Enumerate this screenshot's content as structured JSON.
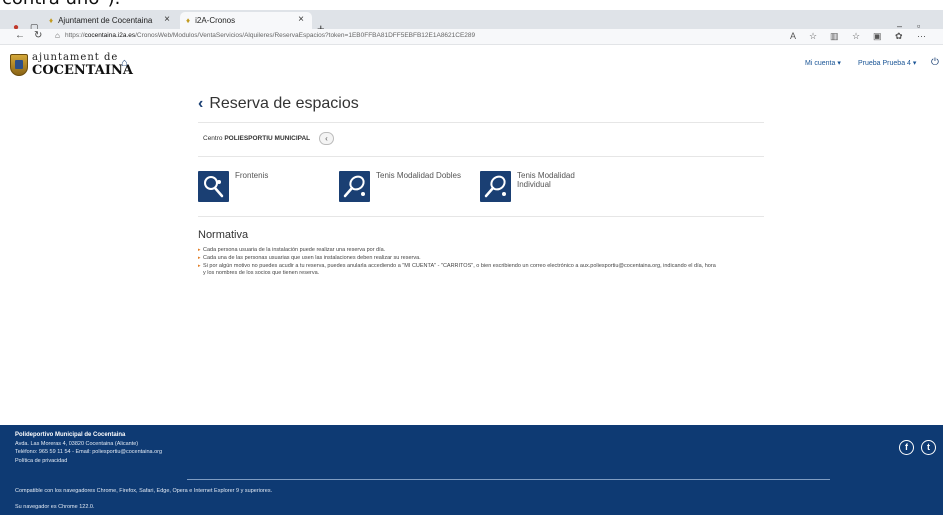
{
  "overlay_text": "contra uno\").",
  "browser": {
    "tabs": [
      {
        "title": "Ajuntament de Cocentaina"
      },
      {
        "title": "i2A-Cronos"
      }
    ],
    "url_prefix": "https://",
    "url_host": "cocentaina.i2a.es",
    "url_path": "/CronosWeb/Modulos/VentaServicios/Alquileres/ReservaEspacios?token=1EB0FFBA81DFF5EBFB12E1A8621CE289"
  },
  "header": {
    "logo_top": "ajuntament de",
    "logo_bottom": "COCENTAINA",
    "account_label": "Mi cuenta",
    "user_label": "Prueba Prueba 4"
  },
  "page": {
    "title": "Reserva de espacios",
    "centro_label": "Centro",
    "centro_value": "POLIESPORTIU MUNICIPAL",
    "services": [
      {
        "label": "Frontenis",
        "icon": "frontenis-icon"
      },
      {
        "label": "Tenis Modalidad Dobles",
        "icon": "tennis-icon"
      },
      {
        "label": "Tenis Modalidad Individual",
        "icon": "tennis-icon"
      }
    ],
    "normativa_title": "Normativa",
    "rules": [
      "Cada persona usuaria de la instalación puede realizar una reserva por día.",
      "Cada una de las personas usuarias que usen las instalaciones deben realizar su reserva.",
      "Si por algún motivo no puedes acudir a tu reserva, puedes anularla accediendo a \"MI CUENTA\" - \"CARRITOS\", o bien escribiendo un correo electrónico a aux.poliesportiu@cocentaina.org, indicando el día, hora y los nombres de los socios que tienen reserva."
    ]
  },
  "footer": {
    "name": "Polideportivo Municipal de Cocentaina",
    "address": "Avda. Las Moreras 4, 03820 Cocentaina (Alicante)",
    "contact": "Teléfono: 965 59 11 54 - Email: poliesportiu@cocentaina.org",
    "privacy": "Política de privacidad",
    "compat": "Compatible con los navegadores Chrome, Firefox, Safari, Edge, Opera e Internet Explorer 9 y superiores.",
    "browser_info": "Su navegador es Chrome 122.0."
  },
  "colors": {
    "brand_navy": "#1a3f73",
    "footer_bg": "#0e3a73",
    "bullet": "#e07a20"
  }
}
